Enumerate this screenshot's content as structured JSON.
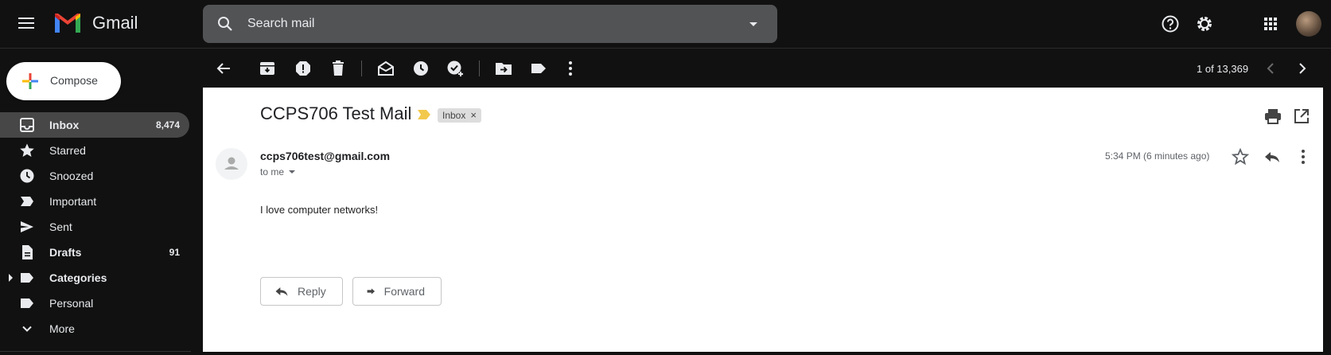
{
  "header": {
    "brand": "Gmail",
    "search_placeholder": "Search mail"
  },
  "sidebar": {
    "compose_label": "Compose",
    "items": [
      {
        "label": "Inbox",
        "count": "8,474",
        "bold": true,
        "active": true
      },
      {
        "label": "Starred",
        "count": "",
        "bold": false
      },
      {
        "label": "Snoozed",
        "count": "",
        "bold": false
      },
      {
        "label": "Important",
        "count": "",
        "bold": false
      },
      {
        "label": "Sent",
        "count": "",
        "bold": false
      },
      {
        "label": "Drafts",
        "count": "91",
        "bold": true
      },
      {
        "label": "Categories",
        "count": "",
        "bold": true
      },
      {
        "label": "Personal",
        "count": "",
        "bold": false
      },
      {
        "label": "More",
        "count": "",
        "bold": false
      }
    ]
  },
  "toolbar": {
    "pager": "1 of 13,369"
  },
  "message": {
    "subject": "CCPS706 Test Mail",
    "label_chip": "Inbox",
    "chip_close": "×",
    "sender": "ccps706test@gmail.com",
    "to": "to me",
    "timestamp": "5:34 PM (6 minutes ago)",
    "body": "I love computer networks!",
    "reply_label": "Reply",
    "forward_label": "Forward"
  },
  "colors": {
    "background": "#111111",
    "active_nav": "#474747",
    "search_bg": "#525355",
    "importance_marker": "#f2c94c"
  },
  "icons": [
    "menu-icon",
    "gmail-logo-icon",
    "search-icon",
    "search-options-icon",
    "help-icon",
    "gear-icon",
    "apps-icon",
    "back-arrow-icon",
    "archive-icon",
    "report-spam-icon",
    "delete-icon",
    "mark-unread-icon",
    "snooze-icon",
    "add-to-tasks-icon",
    "move-to-icon",
    "label-icon",
    "more-vert-icon",
    "chevron-left-icon",
    "chevron-right-icon",
    "print-icon",
    "open-in-new-window-icon",
    "star-icon",
    "reply-icon",
    "forward-icon"
  ]
}
